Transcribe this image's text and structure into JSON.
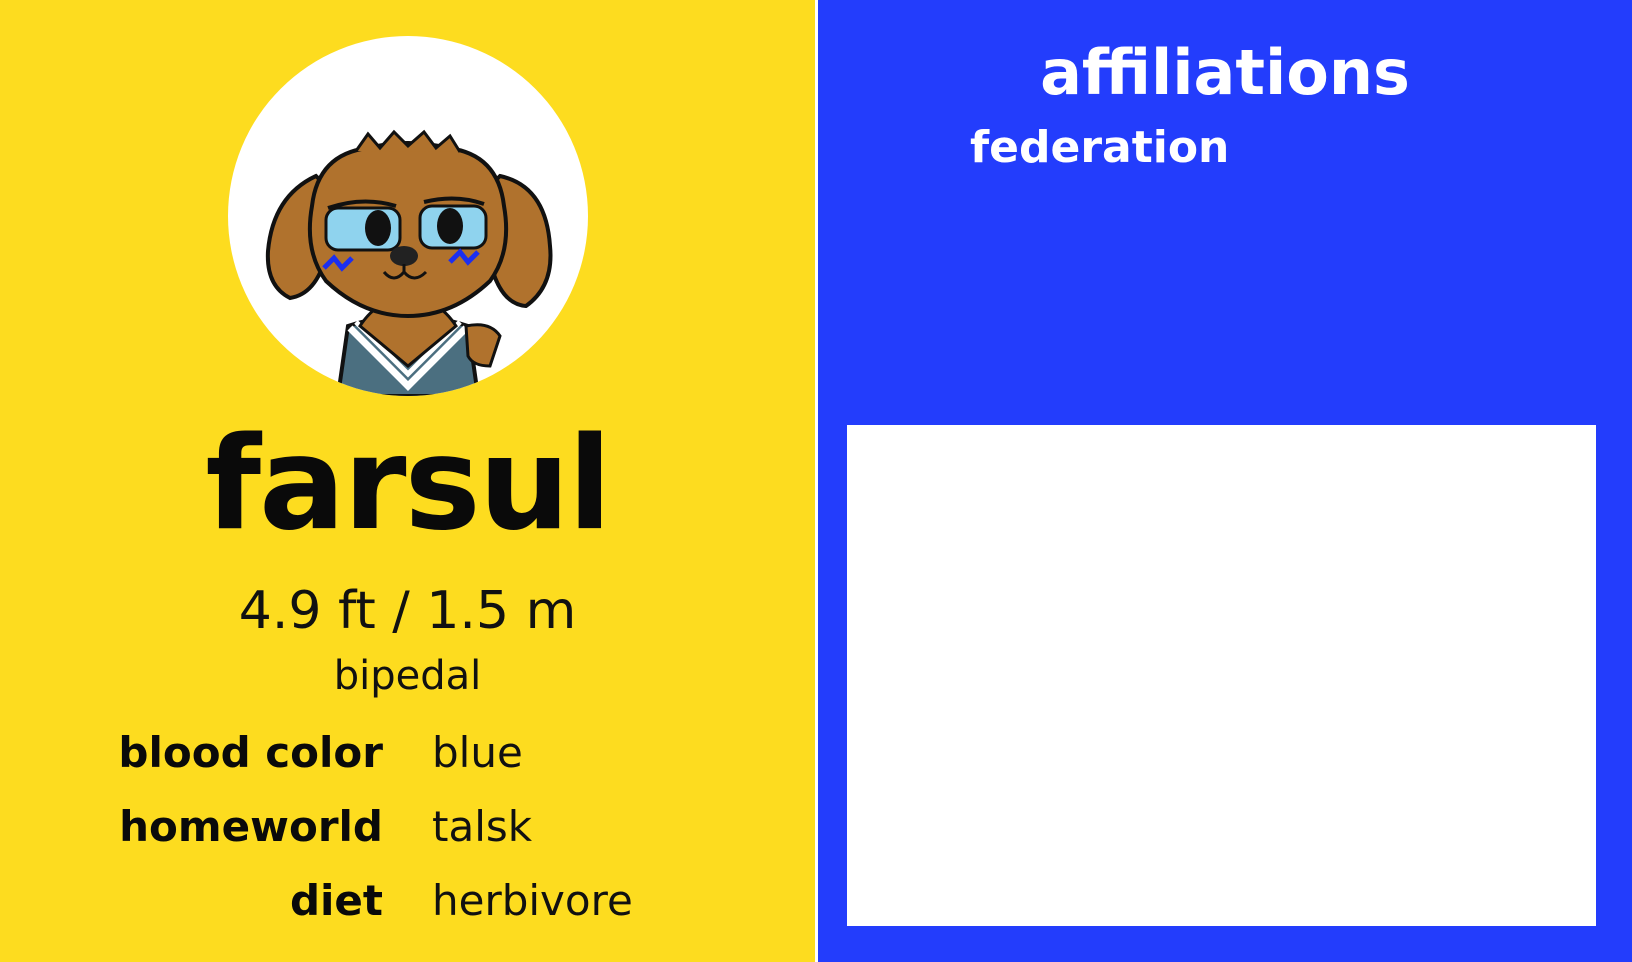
{
  "profile": {
    "name": "farsul",
    "height": "4.9 ft / 1.5 m",
    "locomotion": "bipedal",
    "facts": [
      {
        "label": "blood color",
        "value": "blue"
      },
      {
        "label": "homeworld",
        "value": "talsk"
      },
      {
        "label": "diet",
        "value": "herbivore"
      }
    ]
  },
  "affiliations": {
    "title": "affiliations",
    "items": [
      "federation"
    ]
  },
  "colors": {
    "left_panel": "#fddc1f",
    "right_panel": "#233dfc",
    "text_dark": "#0a0a0a",
    "text_light": "#ffffff"
  },
  "icons": {
    "avatar": "dog-character-portrait"
  }
}
